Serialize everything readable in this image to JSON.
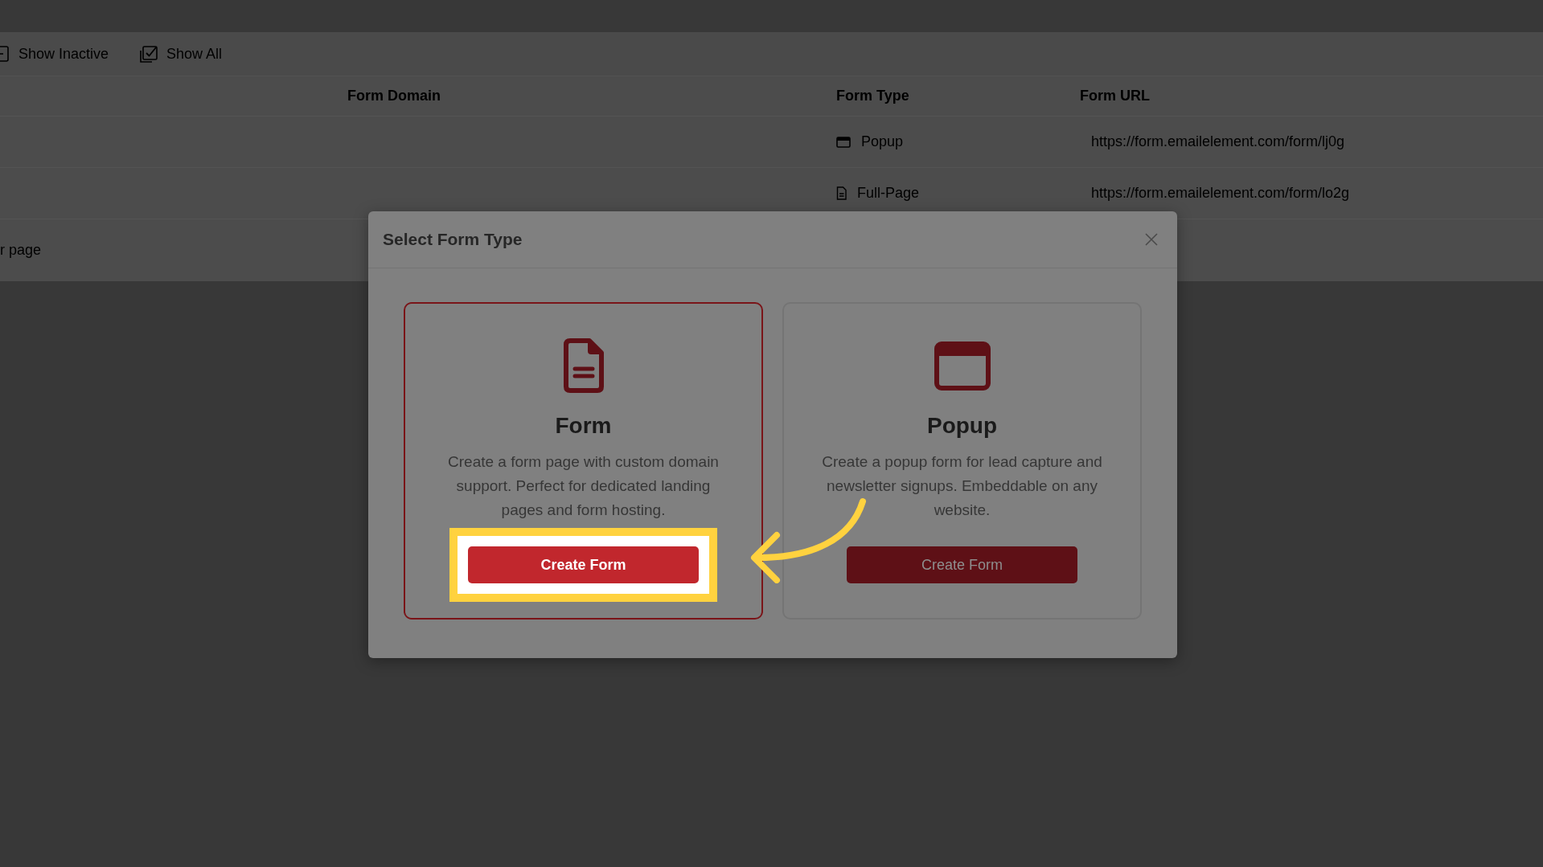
{
  "toolbar": {
    "buttons": [
      {
        "kind": "inactive",
        "label": "Show Inactive"
      },
      {
        "kind": "all",
        "label": "Show All"
      }
    ]
  },
  "table": {
    "columns": [
      {
        "label": "Form Domain"
      },
      {
        "label": "Form Type"
      },
      {
        "label": "Form URL"
      }
    ],
    "rows": [
      {
        "type": {
          "kind": "popup",
          "label": "Popup"
        },
        "url": "https://form.emailelement.com/form/lj0g"
      },
      {
        "type": {
          "kind": "page",
          "label": "Full-Page"
        },
        "url": "https://form.emailelement.com/form/lo2g"
      }
    ],
    "footer": {
      "text": "r page"
    }
  },
  "modal": {
    "title": "Select Form Type",
    "pointer_arrow": true,
    "cards": [
      {
        "kind": "page",
        "title": "Form",
        "description": "Create a form page with custom domain support. Perfect for dedicated landing pages and form hosting.",
        "button": "Create Form",
        "selected": true,
        "highlighted": true
      },
      {
        "kind": "popup",
        "title": "Popup",
        "description": "Create a popup form for lead capture and newsletter signups. Embeddable on any website.",
        "button": "Create Form",
        "selected": false,
        "highlighted": false
      }
    ]
  }
}
